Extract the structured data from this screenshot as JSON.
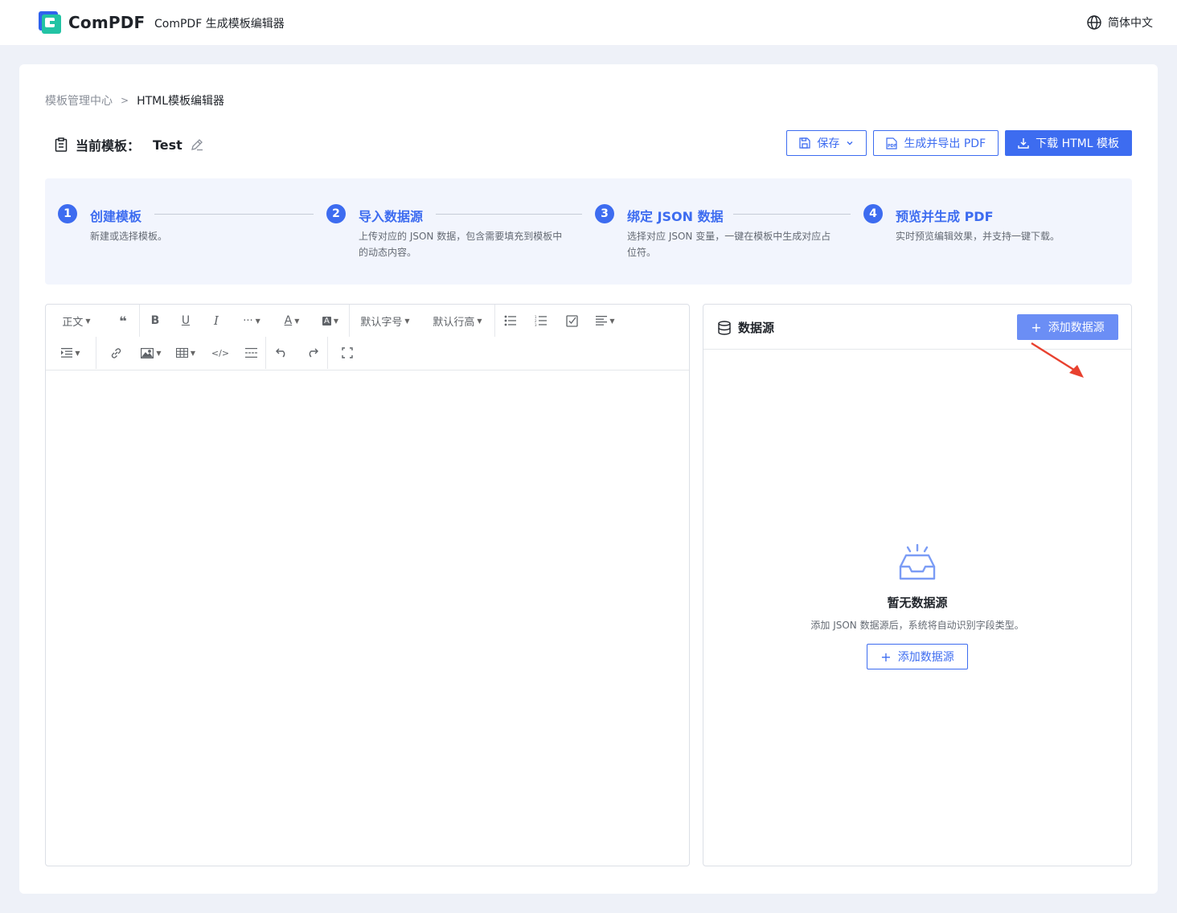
{
  "header": {
    "brand": "ComPDF",
    "app_title": "ComPDF 生成模板编辑器",
    "language": "简体中文"
  },
  "breadcrumb": {
    "parent": "模板管理中心",
    "current": "HTML模板编辑器"
  },
  "template": {
    "label": "当前模板：",
    "name": "Test"
  },
  "actions": {
    "save": "保存",
    "export_pdf": "生成并导出 PDF",
    "download_html": "下载 HTML 模板"
  },
  "steps": [
    {
      "num": "1",
      "title": "创建模板",
      "desc": "新建或选择模板。"
    },
    {
      "num": "2",
      "title": "导入数据源",
      "desc": "上传对应的 JSON 数据，包含需要填充到模板中的动态内容。"
    },
    {
      "num": "3",
      "title": "绑定 JSON 数据",
      "desc": "选择对应 JSON 变量，一键在模板中生成对应占位符。"
    },
    {
      "num": "4",
      "title": "预览并生成 PDF",
      "desc": "实时预览编辑效果，并支持一键下载。"
    }
  ],
  "toolbar": {
    "paragraph": "正文",
    "more": "···",
    "font_size": "默认字号",
    "line_height": "默认行高"
  },
  "datasource": {
    "title": "数据源",
    "add_button": "添加数据源",
    "empty_title": "暂无数据源",
    "empty_desc": "添加 JSON 数据源后，系统将自动识别字段类型。",
    "empty_button": "添加数据源"
  },
  "colors": {
    "primary": "#3d6cf0",
    "annotation_arrow": "#e8412f"
  }
}
